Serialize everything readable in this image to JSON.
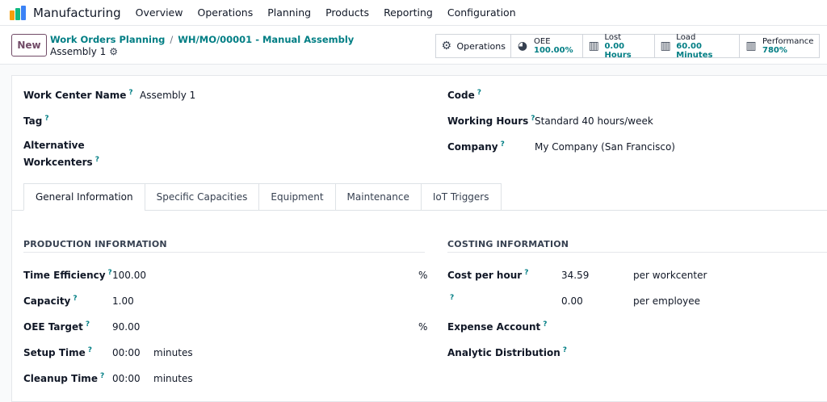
{
  "app": {
    "name": "Manufacturing"
  },
  "menu": [
    "Overview",
    "Operations",
    "Planning",
    "Products",
    "Reporting",
    "Configuration"
  ],
  "control": {
    "new_label": "New",
    "breadcrumb": [
      "Work Orders Planning",
      "WH/MO/00001 - Manual Assembly"
    ],
    "record_title": "Assembly 1"
  },
  "stats": {
    "operations": {
      "label": "Operations",
      "icon": "gear-icon"
    },
    "oee": {
      "label": "OEE",
      "value": "100.00%",
      "icon": "pie-chart-icon"
    },
    "lost": {
      "label": "Lost",
      "value": "0.00 Hours",
      "icon": "bar-chart-icon"
    },
    "load": {
      "label": "Load",
      "value": "60.00 Minutes",
      "icon": "bar-chart-icon"
    },
    "performance": {
      "label": "Performance",
      "value": "780%",
      "icon": "bar-chart-icon"
    }
  },
  "form": {
    "work_center_name": {
      "label": "Work Center Name",
      "value": "Assembly 1"
    },
    "tag": {
      "label": "Tag"
    },
    "alt_line1": "Alternative",
    "alt_line2": "Workcenters",
    "code": {
      "label": "Code"
    },
    "working_hours": {
      "label": "Working Hours",
      "value": "Standard 40 hours/week"
    },
    "company": {
      "label": "Company",
      "value": "My Company (San Francisco)"
    },
    "help": "?"
  },
  "tabs": [
    "General Information",
    "Specific Capacities",
    "Equipment",
    "Maintenance",
    "IoT Triggers"
  ],
  "production": {
    "title": "PRODUCTION INFORMATION",
    "time_efficiency": {
      "label": "Time Efficiency",
      "value": "100.00",
      "unit": "%"
    },
    "capacity": {
      "label": "Capacity",
      "value": "1.00"
    },
    "oee_target": {
      "label": "OEE Target",
      "value": "90.00",
      "unit": "%"
    },
    "setup_time": {
      "label": "Setup Time",
      "value": "00:00",
      "unit": "minutes"
    },
    "cleanup_time": {
      "label": "Cleanup Time",
      "value": "00:00",
      "unit": "minutes"
    }
  },
  "costing": {
    "title": "COSTING INFORMATION",
    "cost_per_hour": {
      "label": "Cost per hour",
      "value": "34.59",
      "unit": "per workcenter"
    },
    "employee_cost": {
      "value": "0.00",
      "unit": "per employee"
    },
    "expense_account": {
      "label": "Expense Account"
    },
    "analytic_distribution": {
      "label": "Analytic Distribution"
    }
  }
}
